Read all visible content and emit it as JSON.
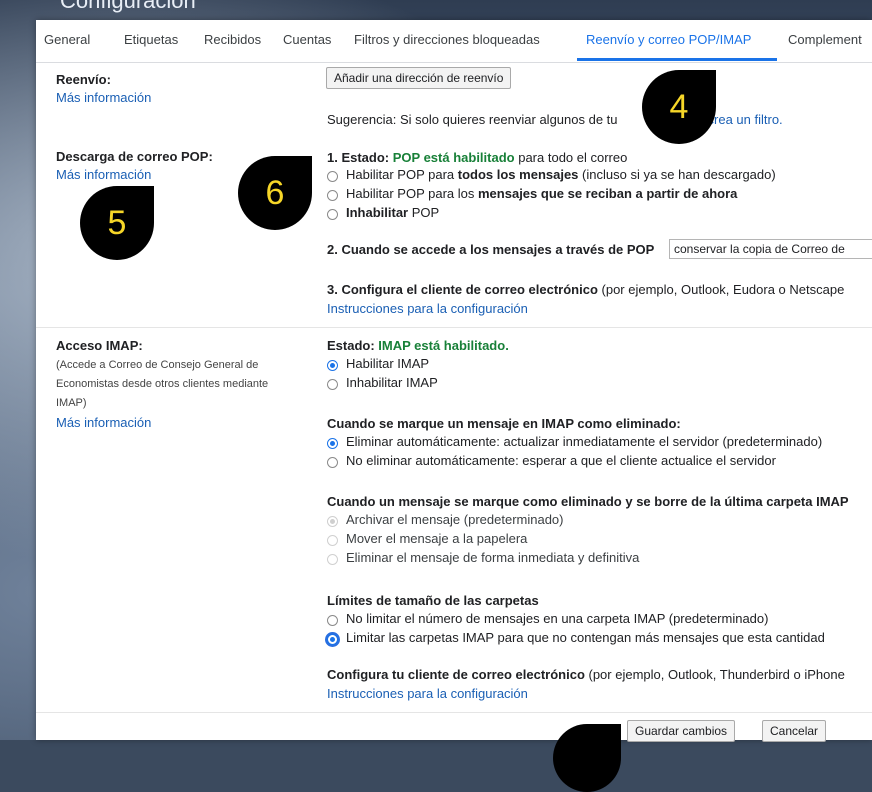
{
  "window": {
    "title": "Configuración"
  },
  "tabs": [
    {
      "label": "General"
    },
    {
      "label": "Etiquetas"
    },
    {
      "label": "Recibidos"
    },
    {
      "label": "Cuentas"
    },
    {
      "label": "Filtros y direcciones bloqueadas"
    },
    {
      "label": "Reenvío y correo POP/IMAP",
      "active": true
    },
    {
      "label": "Complement"
    }
  ],
  "forwarding": {
    "label": "Reenvío:",
    "more_info": "Más información",
    "add_button": "Añadir una dirección de reenvío",
    "tip_text": "Sugerencia: Si solo quieres reenviar algunos de tu",
    "tip_link": "crea un filtro."
  },
  "pop": {
    "label": "Descarga de correo POP:",
    "more_info": "Más información",
    "status_prefix": "1. Estado: ",
    "status_value": "POP está habilitado",
    "status_suffix": " para todo el correo",
    "options": [
      {
        "pre": "Habilitar POP para ",
        "bold": "todos los mensajes",
        "post": " (incluso si ya se han descargado)"
      },
      {
        "pre": "Habilitar POP para los ",
        "bold": "mensajes que se reciban a partir de ahora",
        "post": ""
      },
      {
        "pre": "",
        "bold": "Inhabilitar",
        "post": " POP"
      }
    ],
    "access_label": "2. Cuando se accede a los mensajes a través de POP",
    "access_select": "conservar la copia de Correo de",
    "config_bold": "3. Configura el cliente de correo electrónico",
    "config_rest": " (por ejemplo, Outlook, Eudora o Netscape",
    "config_link": "Instrucciones para la configuración"
  },
  "imap": {
    "label": "Acceso IMAP:",
    "desc_lines": [
      "(Accede a Correo de Consejo General de",
      "Economistas desde otros clientes mediante",
      "IMAP)"
    ],
    "more_info": "Más información",
    "status_prefix": "Estado: ",
    "status_value": "IMAP está habilitado.",
    "enable_options": [
      "Habilitar IMAP",
      "Inhabilitar IMAP"
    ],
    "deleted_title": "Cuando se marque un mensaje en IMAP como eliminado:",
    "deleted_options": [
      "Eliminar automáticamente: actualizar inmediatamente el servidor (predeterminado)",
      "No eliminar automáticamente: esperar a que el cliente actualice el servidor"
    ],
    "expunge_title": "Cuando un mensaje se marque como eliminado y se borre de la última carpeta IMAP",
    "expunge_options": [
      "Archivar el mensaje (predeterminado)",
      "Mover el mensaje a la papelera",
      "Eliminar el mensaje de forma inmediata y definitiva"
    ],
    "limits_title": "Límites de tamaño de las carpetas",
    "limits_options": [
      "No limitar el número de mensajes en una carpeta IMAP (predeterminado)",
      "Limitar las carpetas IMAP para que no contengan más mensajes que esta cantidad"
    ],
    "client_bold": "Configura tu cliente de correo electrónico",
    "client_rest": " (por ejemplo, Outlook, Thunderbird o iPhone",
    "client_link": "Instrucciones para la configuración"
  },
  "footer": {
    "save": "Guardar cambios",
    "cancel": "Cancelar"
  },
  "markers": [
    "4",
    "5",
    "6"
  ],
  "colors": {
    "accent": "#1a73e8",
    "status_green": "#188038",
    "marker_text": "#f6d628"
  }
}
